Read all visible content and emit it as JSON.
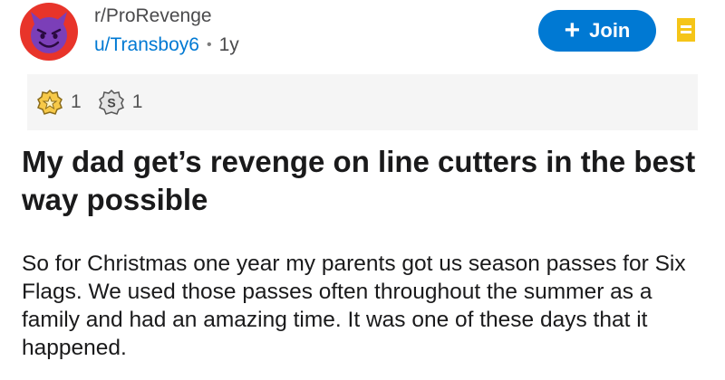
{
  "header": {
    "community": "r/ProRevenge",
    "username": "u/Transboy6",
    "separator": "•",
    "age": "1y",
    "join_label": "Join",
    "join_plus": "+"
  },
  "awards": [
    {
      "icon": "gold-award-icon",
      "count": "1"
    },
    {
      "icon": "silver-award-icon",
      "count": "1"
    }
  ],
  "post": {
    "title": "My dad get’s revenge on line cutters in the best way possible",
    "body": "So for Christmas one year my parents got us season passes for Six Flags. We used those passes often throughout the summer as a family and had an amazing time. It was one of these days that it happened."
  },
  "colors": {
    "accent": "#0079d3",
    "avatar_bg": "#e8342a",
    "devil_face": "#7b3fb8",
    "save_icon": "#f5c518"
  }
}
